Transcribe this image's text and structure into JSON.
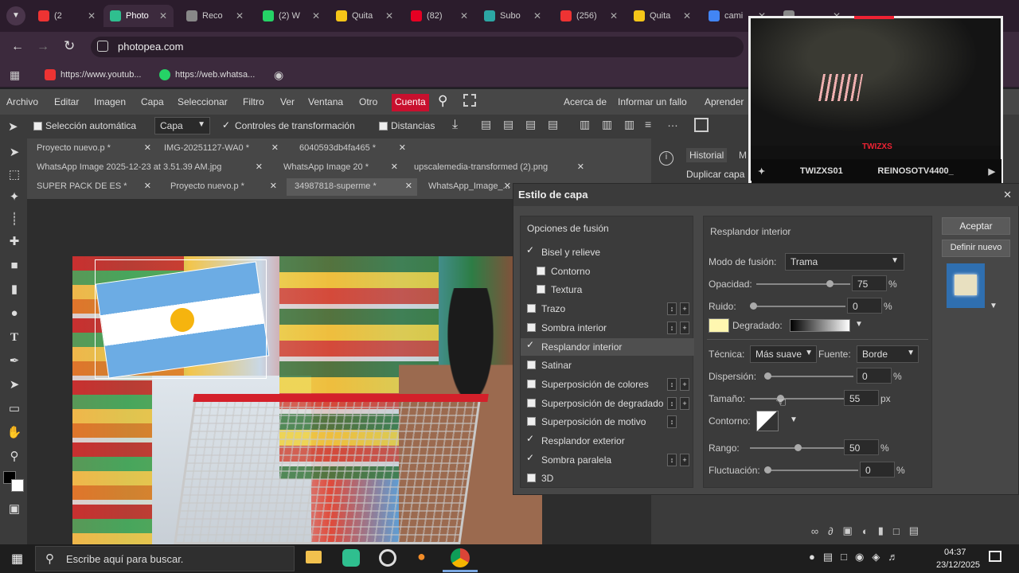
{
  "browser": {
    "tabs": [
      {
        "label": "(2",
        "color": "#e33"
      },
      {
        "label": "Photo",
        "color": "#2fbf8f",
        "active": true
      },
      {
        "label": "Reco",
        "color": "#888"
      },
      {
        "label": "(2) W",
        "color": "#25d366"
      },
      {
        "label": "Quita",
        "color": "#f5c518"
      },
      {
        "label": "(82)",
        "color": "#e60023"
      },
      {
        "label": "Subo",
        "color": "#2ca6a4"
      },
      {
        "label": "(256)",
        "color": "#e33"
      },
      {
        "label": "Quita",
        "color": "#f5c518"
      },
      {
        "label": "cami",
        "color": "#4285f4"
      },
      {
        "label": "...",
        "color": "#888"
      }
    ],
    "url": "photopea.com",
    "bookmarks": [
      "https://www.youtub...",
      "https://web.whatsa..."
    ]
  },
  "menu": {
    "items": [
      "Archivo",
      "Editar",
      "Imagen",
      "Capa",
      "Seleccionar",
      "Filtro",
      "Ver",
      "Ventana",
      "Otro"
    ],
    "highlight": "Cuenta",
    "highlight_color": "#c8102e",
    "right": [
      "Acerca de",
      "Informar un fallo",
      "Aprender"
    ]
  },
  "options": {
    "auto_select_label": "Selección automática",
    "layer_select": "Capa",
    "transform_label": "Controles de transformación",
    "distances_label": "Distancias"
  },
  "doc_tabs": [
    "Proyecto nuevo.p *",
    "IMG-20251127-WA0 *",
    "6040593db4fa465 *",
    "WhatsApp Image 2025-12-23 at 3.51.39 AM.jpg",
    "WhatsApp Image 20 *",
    "upscalemedia-transformed (2).png",
    "SUPER PACK DE ES *",
    "Proyecto nuevo.p *",
    "34987818-superme *",
    "WhatsApp_Image_..."
  ],
  "right_panel": {
    "tab1": "Historial",
    "tab2": "M",
    "history_item": "Duplicar capa"
  },
  "dialog": {
    "title": "Estilo de capa",
    "list_header": "Opciones de fusión",
    "effects": [
      {
        "label": "Bisel y relieve",
        "checked": true
      },
      {
        "label": "Contorno",
        "checked": false
      },
      {
        "label": "Textura",
        "checked": false
      },
      {
        "label": "Trazo",
        "checked": false
      },
      {
        "label": "Sombra interior",
        "checked": false
      },
      {
        "label": "Resplandor interior",
        "checked": true,
        "selected": true
      },
      {
        "label": "Satinar",
        "checked": false
      },
      {
        "label": "Superposición de colores",
        "checked": false
      },
      {
        "label": "Superposición de degradado",
        "checked": false
      },
      {
        "label": "Superposición de motivo",
        "checked": false
      },
      {
        "label": "Resplandor exterior",
        "checked": true
      },
      {
        "label": "Sombra paralela",
        "checked": true
      },
      {
        "label": "3D",
        "checked": false
      }
    ],
    "panel_title": "Resplandor interior",
    "blend_label": "Modo de fusión:",
    "blend_value": "Trama",
    "opacity_label": "Opacidad:",
    "opacity_value": "75",
    "noise_label": "Ruido:",
    "noise_value": "0",
    "gradient_label": "Degradado:",
    "glow_color": "#fff7b0",
    "technique_label": "Técnica:",
    "technique_value": "Más suave",
    "source_label": "Fuente:",
    "source_value": "Borde",
    "choke_label": "Dispersión:",
    "choke_value": "0",
    "size_label": "Tamaño:",
    "size_value": "55",
    "size_unit": "px",
    "contour_label": "Contorno:",
    "range_label": "Rango:",
    "range_value": "50",
    "jitter_label": "Fluctuación:",
    "jitter_value": "0",
    "percent": "%",
    "ok_label": "Aceptar",
    "new_label": "Definir nuevo"
  },
  "webcam": {
    "title_overlay": "TWIZXS",
    "left_handle": "TWIZXS01",
    "right_handle": "REINOSOTV4400_"
  },
  "taskbar": {
    "search_placeholder": "Escribe aquí para buscar.",
    "time": "04:37",
    "date": "23/12/2025"
  }
}
